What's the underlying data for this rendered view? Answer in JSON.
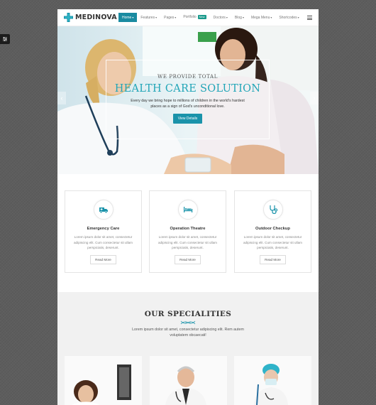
{
  "brand": {
    "name": "MEDINOVA",
    "accent": "#1a8ba1",
    "title_color": "#21a5b7"
  },
  "side_tool": {
    "icon": "sliders-icon"
  },
  "nav": {
    "items": [
      {
        "label": "Home",
        "active": true
      },
      {
        "label": "Features"
      },
      {
        "label": "Pages"
      },
      {
        "label": "Portfolio",
        "badge": "New"
      },
      {
        "label": "Doctors"
      },
      {
        "label": "Blog"
      },
      {
        "label": "Mega Menu"
      },
      {
        "label": "Shortcodes"
      }
    ],
    "menu_icon": "hamburger-icon"
  },
  "hero": {
    "kicker": "WE PROVIDE TOTAL",
    "title": "HEALTH CARE SOLUTION",
    "description": "Every day we bring hope to millions of children in the world's hardest places as a sign of God's unconditional love.",
    "button": "View Details",
    "prev_icon": "chevron-left-icon",
    "next_icon": "chevron-right-icon"
  },
  "services": [
    {
      "title": "Emergency Care",
      "text": "Lorem ipsum dolor sit amet, consectetur adipiscing elit. Cum consectetur sit ullam perspiciatis, deserunt.",
      "button": "Read More",
      "icon": "ambulance-icon"
    },
    {
      "title": "Operation Theatre",
      "text": "Lorem ipsum dolor sit amet, consectetur adipiscing elit. Cum consectetur sit ullam perspiciatis, deserunt.",
      "button": "Read More",
      "icon": "hospital-bed-icon"
    },
    {
      "title": "Outdoor Checkup",
      "text": "Lorem ipsum dolor sit amet, consectetur adipiscing elit. Cum consectetur sit ullam perspiciatis, deserunt.",
      "button": "Read More",
      "icon": "stethoscope-icon"
    }
  ],
  "specialities": {
    "title": "OUR SPECIALITIES",
    "description": "Lorem ipsum dolor sit amet, consectetur adipiscing elit. Rem autem voluptatem obcaecati!",
    "divider_icon": "dna-icon"
  }
}
